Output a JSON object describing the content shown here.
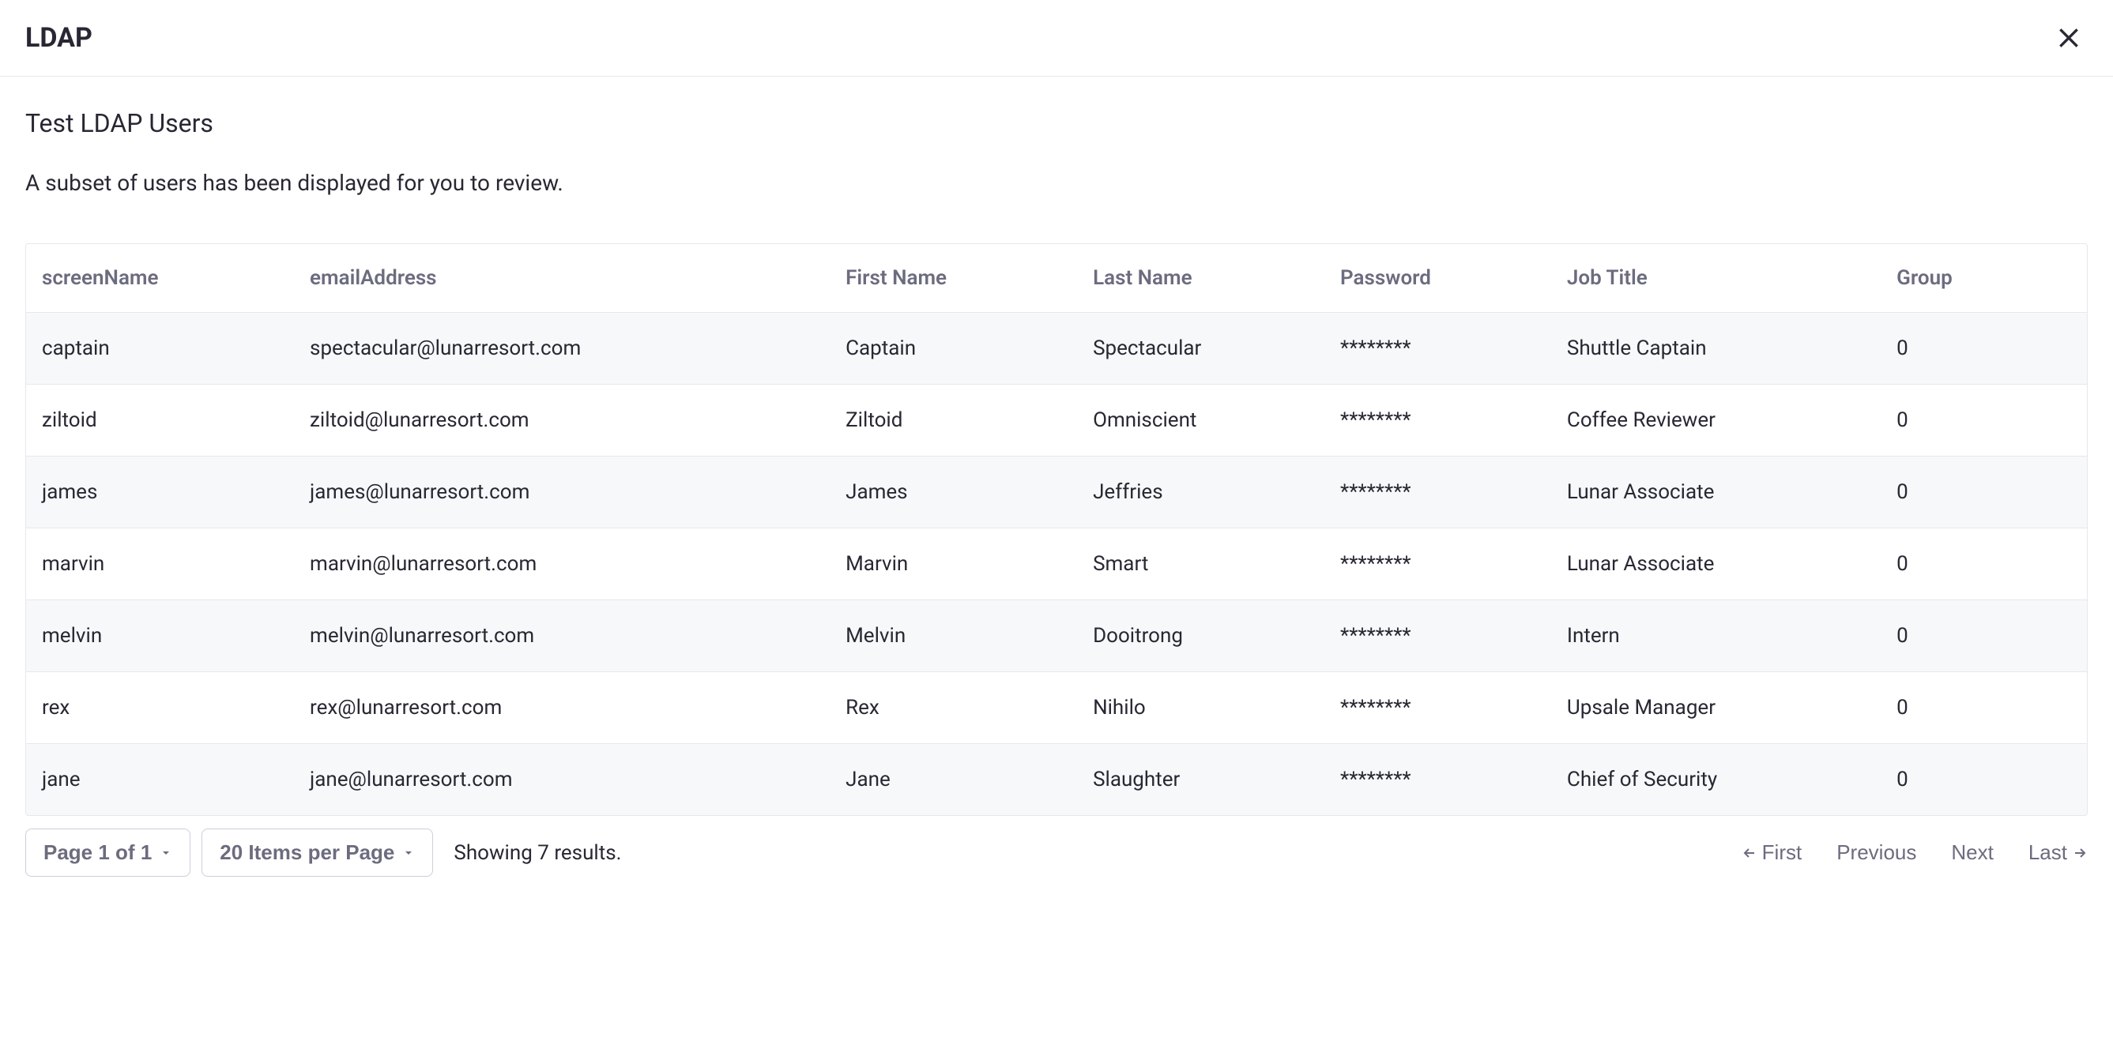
{
  "header": {
    "title": "LDAP"
  },
  "content": {
    "subtitle": "Test LDAP Users",
    "description": "A subset of users has been displayed for you to review."
  },
  "table": {
    "columns": {
      "screenName": "screenName",
      "emailAddress": "emailAddress",
      "firstName": "First Name",
      "lastName": "Last Name",
      "password": "Password",
      "jobTitle": "Job Title",
      "group": "Group"
    },
    "rows": [
      {
        "screenName": "captain",
        "emailAddress": "spectacular@lunarresort.com",
        "firstName": "Captain",
        "lastName": "Spectacular",
        "password": "********",
        "jobTitle": "Shuttle Captain",
        "group": "0"
      },
      {
        "screenName": "ziltoid",
        "emailAddress": "ziltoid@lunarresort.com",
        "firstName": "Ziltoid",
        "lastName": "Omniscient",
        "password": "********",
        "jobTitle": "Coffee Reviewer",
        "group": "0"
      },
      {
        "screenName": "james",
        "emailAddress": "james@lunarresort.com",
        "firstName": "James",
        "lastName": "Jeffries",
        "password": "********",
        "jobTitle": "Lunar Associate",
        "group": "0"
      },
      {
        "screenName": "marvin",
        "emailAddress": "marvin@lunarresort.com",
        "firstName": "Marvin",
        "lastName": "Smart",
        "password": "********",
        "jobTitle": "Lunar Associate",
        "group": "0"
      },
      {
        "screenName": "melvin",
        "emailAddress": "melvin@lunarresort.com",
        "firstName": "Melvin",
        "lastName": "Dooitrong",
        "password": "********",
        "jobTitle": "Intern",
        "group": "0"
      },
      {
        "screenName": "rex",
        "emailAddress": "rex@lunarresort.com",
        "firstName": "Rex",
        "lastName": "Nihilo",
        "password": "********",
        "jobTitle": "Upsale Manager",
        "group": "0"
      },
      {
        "screenName": "jane",
        "emailAddress": "jane@lunarresort.com",
        "firstName": "Jane",
        "lastName": "Slaughter",
        "password": "********",
        "jobTitle": "Chief of Security",
        "group": "0"
      }
    ]
  },
  "pagination": {
    "pageLabel": "Page 1 of 1",
    "itemsPerPage": "20 Items per Page",
    "resultsText": "Showing 7 results.",
    "first": "First",
    "previous": "Previous",
    "next": "Next",
    "last": "Last"
  }
}
